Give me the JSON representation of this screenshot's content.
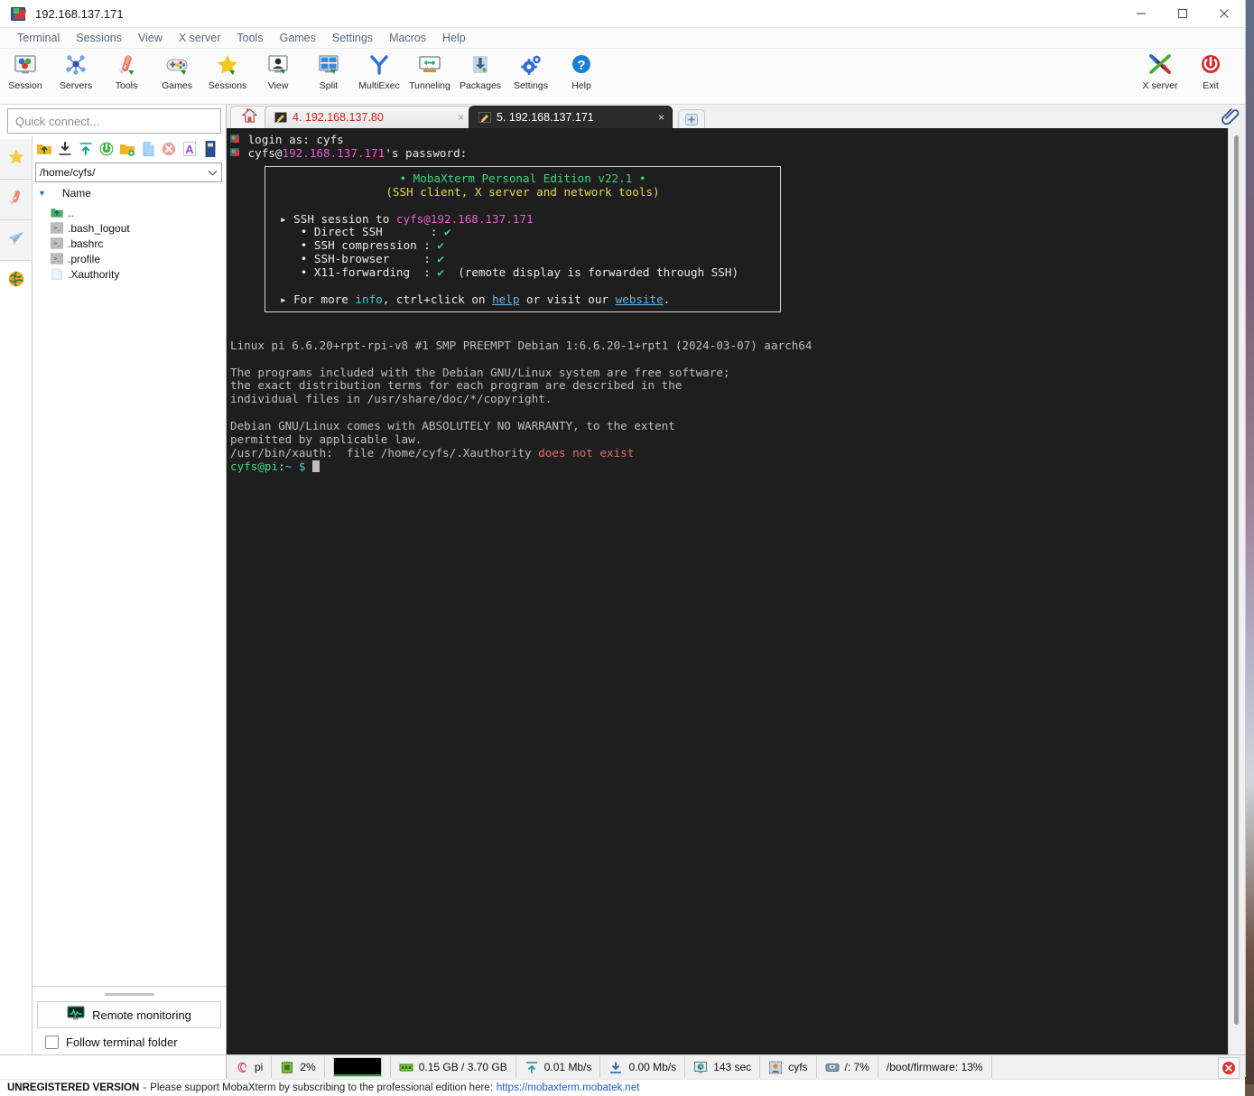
{
  "window": {
    "title": "192.168.137.171",
    "controls": {
      "minimize": "minimize-button",
      "maximize": "maximize-button",
      "close": "close-button"
    }
  },
  "menubar": {
    "items": [
      "Terminal",
      "Sessions",
      "View",
      "X server",
      "Tools",
      "Games",
      "Settings",
      "Macros",
      "Help"
    ]
  },
  "toolbar": {
    "buttons": [
      {
        "label": "Session",
        "icon": "session-icon"
      },
      {
        "label": "Servers",
        "icon": "servers-icon"
      },
      {
        "label": "Tools",
        "icon": "tools-icon"
      },
      {
        "label": "Games",
        "icon": "games-icon"
      },
      {
        "label": "Sessions",
        "icon": "sessions-star-icon"
      },
      {
        "label": "View",
        "icon": "view-icon"
      },
      {
        "label": "Split",
        "icon": "split-icon"
      },
      {
        "label": "MultiExec",
        "icon": "multiexec-icon"
      },
      {
        "label": "Tunneling",
        "icon": "tunneling-icon"
      },
      {
        "label": "Packages",
        "icon": "packages-icon"
      },
      {
        "label": "Settings",
        "icon": "settings-gear-icon"
      },
      {
        "label": "Help",
        "icon": "help-question-icon"
      }
    ],
    "right_buttons": [
      {
        "label": "X server",
        "icon": "x-server-icon"
      },
      {
        "label": "Exit",
        "icon": "power-exit-icon"
      }
    ]
  },
  "sidebar": {
    "quick_connect_placeholder": "Quick connect...",
    "vertical_tabs": [
      {
        "name": "sessions-star-tab",
        "icon": "star-icon"
      },
      {
        "name": "tools-knife-tab",
        "icon": "swiss-knife-icon"
      },
      {
        "name": "macros-plane-tab",
        "icon": "paper-plane-icon"
      },
      {
        "name": "globe-tab",
        "icon": "globe-icon"
      }
    ],
    "file_browser": {
      "toolbar_icons": [
        "go-up-folder-icon",
        "download-icon",
        "upload-icon",
        "refresh-icon",
        "new-folder-icon",
        "new-file-icon",
        "delete-icon",
        "rename-icon",
        "bookmark-icon"
      ],
      "path": "/home/cyfs/",
      "column_header": "Name",
      "files": [
        {
          "name": "..",
          "icon": "parent-folder-icon"
        },
        {
          "name": ".bash_logout",
          "icon": "script-file-icon"
        },
        {
          "name": ".bashrc",
          "icon": "script-file-icon"
        },
        {
          "name": ".profile",
          "icon": "script-file-icon"
        },
        {
          "name": ".Xauthority",
          "icon": "plain-file-icon"
        }
      ]
    },
    "remote_monitoring_label": "Remote monitoring",
    "follow_terminal_folder_label": "Follow terminal folder",
    "follow_terminal_folder_checked": false
  },
  "tabs": {
    "home_icon": "home-icon",
    "new_tab_icon": "plus-icon",
    "clip_icon": "paperclip-icon",
    "items": [
      {
        "label": "4. 192.168.137.80",
        "active": false,
        "close": "×"
      },
      {
        "label": "5. 192.168.137.171",
        "active": true,
        "close": "×"
      }
    ]
  },
  "terminal": {
    "login_line": "login as: cyfs",
    "password_prompt_user": "cyfs@",
    "password_prompt_host": "192.168.137.171",
    "password_prompt_tail": "'s password:",
    "banner": {
      "title": "• MobaXterm Personal Edition v22.1 •",
      "subtitle": "(SSH client, X server and network tools)",
      "session_prefix": "▸ SSH session to ",
      "session_target": "cyfs@192.168.137.171",
      "features": [
        {
          "label": "Direct SSH",
          "pad": "      ",
          "check": "✔",
          "note": ""
        },
        {
          "label": "SSH compression",
          "pad": "",
          "check": "✔",
          "note": ""
        },
        {
          "label": "SSH-browser",
          "pad": "    ",
          "check": "✔",
          "note": ""
        },
        {
          "label": "X11-forwarding",
          "pad": " ",
          "check": "✔",
          "note": "(remote display is forwarded through SSH)"
        }
      ],
      "footer_a": "▸ For more ",
      "footer_info": "info",
      "footer_b": ", ctrl+click on ",
      "footer_help": "help",
      "footer_c": " or visit our ",
      "footer_website": "website",
      "footer_d": "."
    },
    "uname_line": "Linux pi 6.6.20+rpt-rpi-v8 #1 SMP PREEMPT Debian 1:6.6.20-1+rpt1 (2024-03-07) aarch64",
    "motd": [
      "The programs included with the Debian GNU/Linux system are free software;",
      "the exact distribution terms for each program are described in the",
      "individual files in /usr/share/doc/*/copyright."
    ],
    "warranty": [
      "Debian GNU/Linux comes with ABSOLUTELY NO WARRANTY, to the extent",
      "permitted by applicable law."
    ],
    "xauth_prefix": "/usr/bin/xauth:  file /home/cyfs/.Xauthority ",
    "xauth_error": "does not exist",
    "prompt_user_host": "cyfs@pi",
    "prompt_sep": ":",
    "prompt_path": "~",
    "prompt_symbol": "$"
  },
  "statusbar": {
    "cells": [
      {
        "icon": "debian-logo-icon",
        "text": "pi"
      },
      {
        "icon": "cpu-chip-icon",
        "text": "2%"
      },
      {
        "icon": "cpu-graph-icon",
        "text": ""
      },
      {
        "icon": "memory-ram-icon",
        "text": "0.15 GB / 3.70 GB"
      },
      {
        "icon": "upload-arrow-icon",
        "text": "0.01 Mb/s"
      },
      {
        "icon": "download-arrow-icon",
        "text": "0.00 Mb/s"
      },
      {
        "icon": "uptime-clock-icon",
        "text": "143 sec"
      },
      {
        "icon": "user-icon",
        "text": "cyfs"
      },
      {
        "icon": "disk-icon",
        "text": "/: 7%"
      },
      {
        "icon": "",
        "text": "/boot/firmware: 13%"
      }
    ],
    "close_icon": "close-status-icon"
  },
  "footer": {
    "badge": "UNREGISTERED VERSION",
    "dash": "-",
    "message": "Please support MobaXterm by subscribing to the professional edition here:",
    "link": "https://mobaxterm.mobatek.net"
  },
  "colors": {
    "accent_blue": "#1e70c8",
    "terminal_bg": "#1e1e1e",
    "green": "#37d67a",
    "yellow": "#e6d84a",
    "magenta": "#e85ad0",
    "red": "#e06a6a",
    "link": "#5fb7e8"
  }
}
